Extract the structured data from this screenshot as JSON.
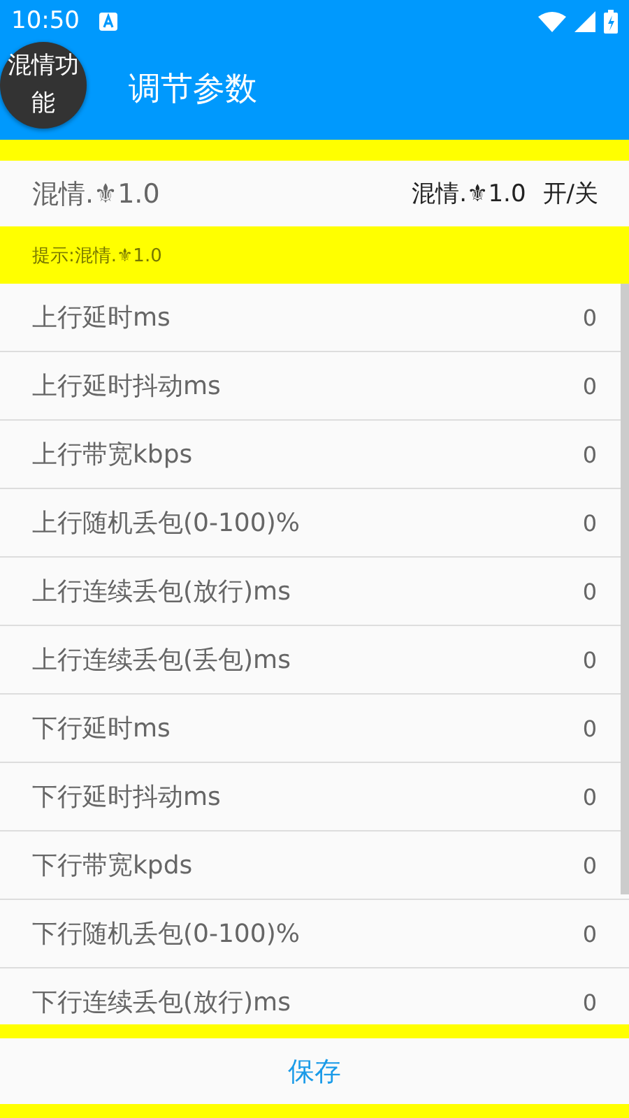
{
  "status_bar": {
    "time": "10:50"
  },
  "app_bar": {
    "menu_button": "混情功能",
    "title": "调节参数"
  },
  "header": {
    "name": "混情.⚜1.0",
    "right_label": "混情.⚜1.0",
    "toggle": "开/关"
  },
  "hint": "提示:混情.⚜1.0",
  "params": [
    {
      "label": "上行延时ms",
      "value": "0"
    },
    {
      "label": "上行延时抖动ms",
      "value": "0"
    },
    {
      "label": "上行带宽kbps",
      "value": "0"
    },
    {
      "label": "上行随机丢包(0-100)%",
      "value": "0"
    },
    {
      "label": "上行连续丢包(放行)ms",
      "value": "0"
    },
    {
      "label": "上行连续丢包(丢包)ms",
      "value": "0"
    },
    {
      "label": "下行延时ms",
      "value": "0"
    },
    {
      "label": "下行延时抖动ms",
      "value": "0"
    },
    {
      "label": "下行带宽kpds",
      "value": "0"
    },
    {
      "label": "下行随机丢包(0-100)%",
      "value": "0"
    },
    {
      "label": "下行连续丢包(放行)ms",
      "value": "0"
    }
  ],
  "save_button": "保存"
}
